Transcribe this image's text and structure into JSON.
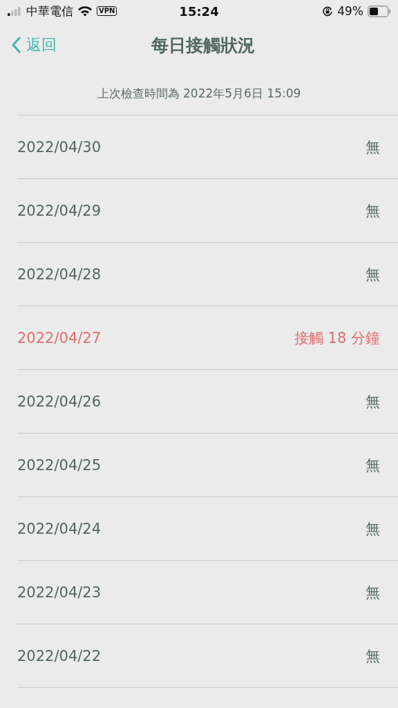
{
  "status_bar": {
    "carrier": "中華電信",
    "vpn": "VPN",
    "time": "15:24",
    "battery_percent": "49%"
  },
  "nav": {
    "back": "返回",
    "title": "每日接觸狀況"
  },
  "last_check": "上次檢查時間為 2022年5月6日 15:09",
  "rows": [
    {
      "date": "2022/04/30",
      "status": "無",
      "contact": false
    },
    {
      "date": "2022/04/29",
      "status": "無",
      "contact": false
    },
    {
      "date": "2022/04/28",
      "status": "無",
      "contact": false
    },
    {
      "date": "2022/04/27",
      "status": "接觸 18 分鐘",
      "contact": true
    },
    {
      "date": "2022/04/26",
      "status": "無",
      "contact": false
    },
    {
      "date": "2022/04/25",
      "status": "無",
      "contact": false
    },
    {
      "date": "2022/04/24",
      "status": "無",
      "contact": false
    },
    {
      "date": "2022/04/23",
      "status": "無",
      "contact": false
    },
    {
      "date": "2022/04/22",
      "status": "無",
      "contact": false
    }
  ]
}
